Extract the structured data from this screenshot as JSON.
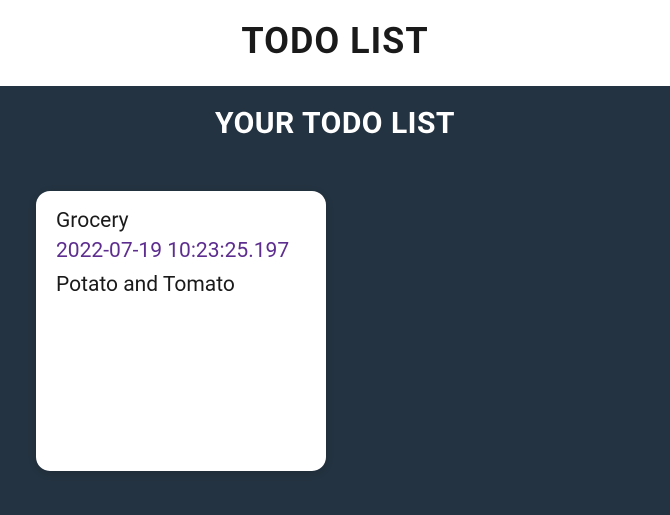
{
  "header": {
    "title": "TODO LIST"
  },
  "main": {
    "subtitle": "YOUR TODO LIST",
    "todos": [
      {
        "title": "Grocery",
        "date": "2022-07-19 10:23:25.197",
        "body": "Potato and Tomato"
      }
    ]
  }
}
